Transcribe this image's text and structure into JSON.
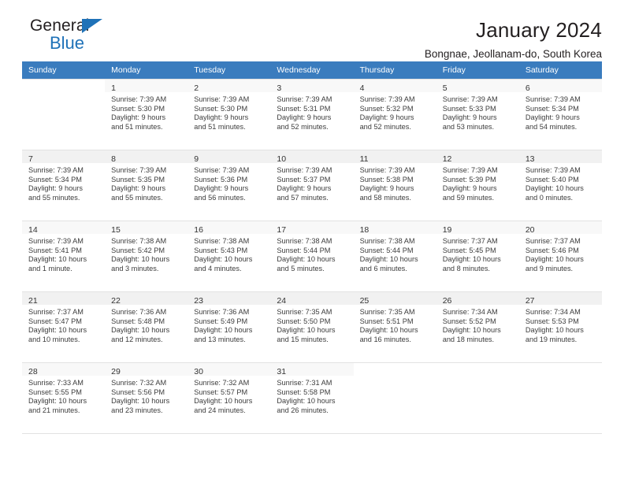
{
  "brand": {
    "name_top": "General",
    "name_bottom": "Blue",
    "accent_color": "#1f72b8"
  },
  "header": {
    "title": "January 2024",
    "subtitle": "Bongnae, Jeollanam-do, South Korea"
  },
  "calendar": {
    "header_bg": "#3a7cbe",
    "weekday_headers": [
      "Sunday",
      "Monday",
      "Tuesday",
      "Wednesday",
      "Thursday",
      "Friday",
      "Saturday"
    ],
    "weeks": [
      [
        {
          "day": "",
          "lines": []
        },
        {
          "day": "1",
          "lines": [
            "Sunrise: 7:39 AM",
            "Sunset: 5:30 PM",
            "Daylight: 9 hours",
            "and 51 minutes."
          ]
        },
        {
          "day": "2",
          "lines": [
            "Sunrise: 7:39 AM",
            "Sunset: 5:30 PM",
            "Daylight: 9 hours",
            "and 51 minutes."
          ]
        },
        {
          "day": "3",
          "lines": [
            "Sunrise: 7:39 AM",
            "Sunset: 5:31 PM",
            "Daylight: 9 hours",
            "and 52 minutes."
          ]
        },
        {
          "day": "4",
          "lines": [
            "Sunrise: 7:39 AM",
            "Sunset: 5:32 PM",
            "Daylight: 9 hours",
            "and 52 minutes."
          ]
        },
        {
          "day": "5",
          "lines": [
            "Sunrise: 7:39 AM",
            "Sunset: 5:33 PM",
            "Daylight: 9 hours",
            "and 53 minutes."
          ]
        },
        {
          "day": "6",
          "lines": [
            "Sunrise: 7:39 AM",
            "Sunset: 5:34 PM",
            "Daylight: 9 hours",
            "and 54 minutes."
          ]
        }
      ],
      [
        {
          "day": "7",
          "lines": [
            "Sunrise: 7:39 AM",
            "Sunset: 5:34 PM",
            "Daylight: 9 hours",
            "and 55 minutes."
          ]
        },
        {
          "day": "8",
          "lines": [
            "Sunrise: 7:39 AM",
            "Sunset: 5:35 PM",
            "Daylight: 9 hours",
            "and 55 minutes."
          ]
        },
        {
          "day": "9",
          "lines": [
            "Sunrise: 7:39 AM",
            "Sunset: 5:36 PM",
            "Daylight: 9 hours",
            "and 56 minutes."
          ]
        },
        {
          "day": "10",
          "lines": [
            "Sunrise: 7:39 AM",
            "Sunset: 5:37 PM",
            "Daylight: 9 hours",
            "and 57 minutes."
          ]
        },
        {
          "day": "11",
          "lines": [
            "Sunrise: 7:39 AM",
            "Sunset: 5:38 PM",
            "Daylight: 9 hours",
            "and 58 minutes."
          ]
        },
        {
          "day": "12",
          "lines": [
            "Sunrise: 7:39 AM",
            "Sunset: 5:39 PM",
            "Daylight: 9 hours",
            "and 59 minutes."
          ]
        },
        {
          "day": "13",
          "lines": [
            "Sunrise: 7:39 AM",
            "Sunset: 5:40 PM",
            "Daylight: 10 hours",
            "and 0 minutes."
          ]
        }
      ],
      [
        {
          "day": "14",
          "lines": [
            "Sunrise: 7:39 AM",
            "Sunset: 5:41 PM",
            "Daylight: 10 hours",
            "and 1 minute."
          ]
        },
        {
          "day": "15",
          "lines": [
            "Sunrise: 7:38 AM",
            "Sunset: 5:42 PM",
            "Daylight: 10 hours",
            "and 3 minutes."
          ]
        },
        {
          "day": "16",
          "lines": [
            "Sunrise: 7:38 AM",
            "Sunset: 5:43 PM",
            "Daylight: 10 hours",
            "and 4 minutes."
          ]
        },
        {
          "day": "17",
          "lines": [
            "Sunrise: 7:38 AM",
            "Sunset: 5:44 PM",
            "Daylight: 10 hours",
            "and 5 minutes."
          ]
        },
        {
          "day": "18",
          "lines": [
            "Sunrise: 7:38 AM",
            "Sunset: 5:44 PM",
            "Daylight: 10 hours",
            "and 6 minutes."
          ]
        },
        {
          "day": "19",
          "lines": [
            "Sunrise: 7:37 AM",
            "Sunset: 5:45 PM",
            "Daylight: 10 hours",
            "and 8 minutes."
          ]
        },
        {
          "day": "20",
          "lines": [
            "Sunrise: 7:37 AM",
            "Sunset: 5:46 PM",
            "Daylight: 10 hours",
            "and 9 minutes."
          ]
        }
      ],
      [
        {
          "day": "21",
          "lines": [
            "Sunrise: 7:37 AM",
            "Sunset: 5:47 PM",
            "Daylight: 10 hours",
            "and 10 minutes."
          ]
        },
        {
          "day": "22",
          "lines": [
            "Sunrise: 7:36 AM",
            "Sunset: 5:48 PM",
            "Daylight: 10 hours",
            "and 12 minutes."
          ]
        },
        {
          "day": "23",
          "lines": [
            "Sunrise: 7:36 AM",
            "Sunset: 5:49 PM",
            "Daylight: 10 hours",
            "and 13 minutes."
          ]
        },
        {
          "day": "24",
          "lines": [
            "Sunrise: 7:35 AM",
            "Sunset: 5:50 PM",
            "Daylight: 10 hours",
            "and 15 minutes."
          ]
        },
        {
          "day": "25",
          "lines": [
            "Sunrise: 7:35 AM",
            "Sunset: 5:51 PM",
            "Daylight: 10 hours",
            "and 16 minutes."
          ]
        },
        {
          "day": "26",
          "lines": [
            "Sunrise: 7:34 AM",
            "Sunset: 5:52 PM",
            "Daylight: 10 hours",
            "and 18 minutes."
          ]
        },
        {
          "day": "27",
          "lines": [
            "Sunrise: 7:34 AM",
            "Sunset: 5:53 PM",
            "Daylight: 10 hours",
            "and 19 minutes."
          ]
        }
      ],
      [
        {
          "day": "28",
          "lines": [
            "Sunrise: 7:33 AM",
            "Sunset: 5:55 PM",
            "Daylight: 10 hours",
            "and 21 minutes."
          ]
        },
        {
          "day": "29",
          "lines": [
            "Sunrise: 7:32 AM",
            "Sunset: 5:56 PM",
            "Daylight: 10 hours",
            "and 23 minutes."
          ]
        },
        {
          "day": "30",
          "lines": [
            "Sunrise: 7:32 AM",
            "Sunset: 5:57 PM",
            "Daylight: 10 hours",
            "and 24 minutes."
          ]
        },
        {
          "day": "31",
          "lines": [
            "Sunrise: 7:31 AM",
            "Sunset: 5:58 PM",
            "Daylight: 10 hours",
            "and 26 minutes."
          ]
        },
        {
          "day": "",
          "lines": []
        },
        {
          "day": "",
          "lines": []
        },
        {
          "day": "",
          "lines": []
        }
      ]
    ]
  }
}
